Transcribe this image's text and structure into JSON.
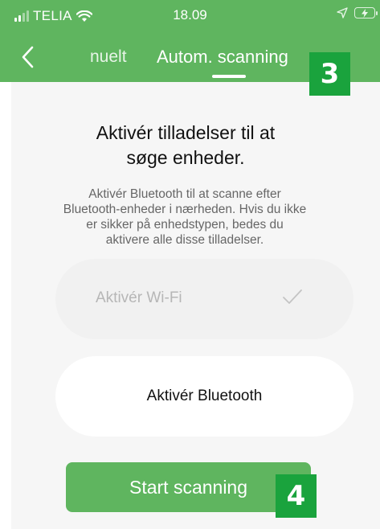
{
  "status_bar": {
    "carrier": "TELIA",
    "time": "18.09"
  },
  "nav": {
    "back_icon": "chevron-left-icon",
    "tab_manual": "nuelt",
    "tab_auto": "Autom. scanning"
  },
  "annotations": {
    "badge_3": "3",
    "badge_4": "4"
  },
  "content": {
    "heading_line1": "Aktivér tilladelser til at",
    "heading_line2": "søge enheder.",
    "desc_lines": [
      "Aktivér Bluetooth til at scanne efter",
      "Bluetooth-enheder i nærheden. Hvis du ikke",
      "er sikker på enhedstypen, bedes du",
      "aktivere alle disse tilladelser."
    ],
    "wifi_label": "Aktivér Wi-Fi",
    "wifi_state_icon": "checkmark-icon",
    "bluetooth_label": "Aktivér Bluetooth",
    "start_button": "Start scanning"
  },
  "colors": {
    "brand_green": "#5fb55f",
    "badge_green": "#1aa33d",
    "background": "#f6f6f6"
  }
}
